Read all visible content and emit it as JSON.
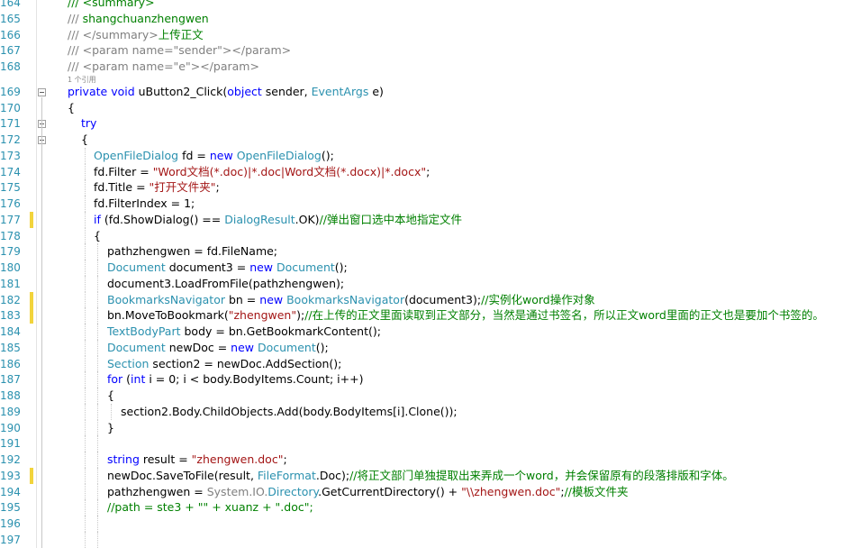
{
  "editor": {
    "reference_hint": "1 个引用",
    "lines": [
      {
        "n": "164",
        "indent": 0,
        "segs": [
          [
            "c",
            "/// <summary>"
          ]
        ]
      },
      {
        "n": "165",
        "indent": 0,
        "segs": [
          [
            "g",
            "/// "
          ],
          [
            "c",
            "shangchuanzhengwen"
          ]
        ]
      },
      {
        "n": "166",
        "indent": 0,
        "segs": [
          [
            "g",
            "/// </summary>"
          ],
          [
            "c",
            "上传正文"
          ]
        ]
      },
      {
        "n": "167",
        "indent": 0,
        "segs": [
          [
            "g",
            "/// <param name=\"sender\"></param>"
          ]
        ]
      },
      {
        "n": "168",
        "indent": 0,
        "segs": [
          [
            "g",
            "/// <param name=\"e\"></param>"
          ]
        ]
      },
      {
        "n": "169",
        "indent": 0,
        "segs": [
          [
            "k",
            "private"
          ],
          [
            "p",
            " "
          ],
          [
            "k",
            "void"
          ],
          [
            "p",
            " uButton2_Click("
          ],
          [
            "k",
            "object"
          ],
          [
            "p",
            " sender, "
          ],
          [
            "t",
            "EventArgs"
          ],
          [
            "p",
            " e)"
          ]
        ]
      },
      {
        "n": "170",
        "indent": 0,
        "segs": [
          [
            "p",
            "{"
          ]
        ]
      },
      {
        "n": "171",
        "indent": 1,
        "segs": [
          [
            "k",
            "try"
          ]
        ]
      },
      {
        "n": "172",
        "indent": 1,
        "segs": [
          [
            "p",
            "{"
          ]
        ]
      },
      {
        "n": "173",
        "indent": 2,
        "segs": [
          [
            "t",
            "OpenFileDialog"
          ],
          [
            "p",
            " fd = "
          ],
          [
            "k",
            "new"
          ],
          [
            "p",
            " "
          ],
          [
            "t",
            "OpenFileDialog"
          ],
          [
            "p",
            "();"
          ]
        ]
      },
      {
        "n": "174",
        "indent": 2,
        "segs": [
          [
            "p",
            "fd.Filter = "
          ],
          [
            "s",
            "\"Word文档(*.doc)|*.doc|Word文档(*.docx)|*.docx\""
          ],
          [
            "p",
            ";"
          ]
        ]
      },
      {
        "n": "175",
        "indent": 2,
        "segs": [
          [
            "p",
            "fd.Title = "
          ],
          [
            "s",
            "\"打开文件夹\""
          ],
          [
            "p",
            ";"
          ]
        ]
      },
      {
        "n": "176",
        "indent": 2,
        "segs": [
          [
            "p",
            "fd.FilterIndex = 1;"
          ]
        ]
      },
      {
        "n": "177",
        "indent": 2,
        "segs": [
          [
            "k",
            "if"
          ],
          [
            "p",
            " (fd.ShowDialog() == "
          ],
          [
            "t",
            "DialogResult"
          ],
          [
            "p",
            ".OK)"
          ],
          [
            "c",
            "//弹出窗口选中本地指定文件"
          ]
        ]
      },
      {
        "n": "178",
        "indent": 2,
        "segs": [
          [
            "p",
            "{"
          ]
        ]
      },
      {
        "n": "179",
        "indent": 3,
        "segs": [
          [
            "p",
            "pathzhengwen = fd.FileName;"
          ]
        ]
      },
      {
        "n": "180",
        "indent": 3,
        "segs": [
          [
            "t",
            "Document"
          ],
          [
            "p",
            " document3 = "
          ],
          [
            "k",
            "new"
          ],
          [
            "p",
            " "
          ],
          [
            "t",
            "Document"
          ],
          [
            "p",
            "();"
          ]
        ]
      },
      {
        "n": "181",
        "indent": 3,
        "segs": [
          [
            "p",
            "document3.LoadFromFile(pathzhengwen);"
          ]
        ]
      },
      {
        "n": "182",
        "indent": 3,
        "segs": [
          [
            "t",
            "BookmarksNavigator"
          ],
          [
            "p",
            " bn = "
          ],
          [
            "k",
            "new"
          ],
          [
            "p",
            " "
          ],
          [
            "t",
            "BookmarksNavigator"
          ],
          [
            "p",
            "(document3);"
          ],
          [
            "c",
            "//实例化word操作对象"
          ]
        ]
      },
      {
        "n": "183",
        "indent": 3,
        "segs": [
          [
            "p",
            "bn.MoveToBookmark("
          ],
          [
            "s",
            "\"zhengwen\""
          ],
          [
            "p",
            ");"
          ],
          [
            "c",
            "//在上传的正文里面读取到正文部分，当然是通过书签名，所以正文word里面的正文也是要加个书签的。"
          ]
        ]
      },
      {
        "n": "184",
        "indent": 3,
        "segs": [
          [
            "t",
            "TextBodyPart"
          ],
          [
            "p",
            " body = bn.GetBookmarkContent();"
          ]
        ]
      },
      {
        "n": "185",
        "indent": 3,
        "segs": [
          [
            "t",
            "Document"
          ],
          [
            "p",
            " newDoc = "
          ],
          [
            "k",
            "new"
          ],
          [
            "p",
            " "
          ],
          [
            "t",
            "Document"
          ],
          [
            "p",
            "();"
          ]
        ]
      },
      {
        "n": "186",
        "indent": 3,
        "segs": [
          [
            "t",
            "Section"
          ],
          [
            "p",
            " section2 = newDoc.AddSection();"
          ]
        ]
      },
      {
        "n": "187",
        "indent": 3,
        "segs": [
          [
            "k",
            "for"
          ],
          [
            "p",
            " ("
          ],
          [
            "k",
            "int"
          ],
          [
            "p",
            " i = 0; i < body.BodyItems.Count; i++)"
          ]
        ]
      },
      {
        "n": "188",
        "indent": 3,
        "segs": [
          [
            "p",
            "{"
          ]
        ]
      },
      {
        "n": "189",
        "indent": 4,
        "segs": [
          [
            "p",
            "section2.Body.ChildObjects.Add(body.BodyItems[i].Clone());"
          ]
        ]
      },
      {
        "n": "190",
        "indent": 3,
        "segs": [
          [
            "p",
            "}"
          ]
        ]
      },
      {
        "n": "191",
        "indent": 3,
        "segs": []
      },
      {
        "n": "192",
        "indent": 3,
        "segs": [
          [
            "k",
            "string"
          ],
          [
            "p",
            " result = "
          ],
          [
            "s",
            "\"zhengwen.doc\""
          ],
          [
            "p",
            ";"
          ]
        ]
      },
      {
        "n": "193",
        "indent": 3,
        "segs": [
          [
            "p",
            "newDoc.SaveToFile(result, "
          ],
          [
            "t",
            "FileFormat"
          ],
          [
            "p",
            ".Doc);"
          ],
          [
            "c",
            "//将正文部门单独提取出来弄成一个word，并会保留原有的段落排版和字体。"
          ]
        ]
      },
      {
        "n": "194",
        "indent": 3,
        "segs": [
          [
            "p",
            "pathzhengwen = "
          ],
          [
            "g",
            "System.IO."
          ],
          [
            "t",
            "Directory"
          ],
          [
            "p",
            ".GetCurrentDirectory() + "
          ],
          [
            "s",
            "\"\\\\zhengwen.doc\""
          ],
          [
            "p",
            ";"
          ],
          [
            "c",
            "//模板文件夹"
          ]
        ]
      },
      {
        "n": "195",
        "indent": 3,
        "segs": [
          [
            "c",
            "//path = ste3 + \"\" + xuanz + \".doc\";"
          ]
        ]
      },
      {
        "n": "196",
        "indent": 3,
        "segs": []
      },
      {
        "n": "197",
        "indent": 3,
        "segs": []
      }
    ]
  },
  "change_marker_color": "#f2d43c",
  "colors": {
    "keyword": "#0000ff",
    "type": "#2b91af",
    "string": "#a31515",
    "comment": "#008000",
    "doc_comment": "#808080"
  }
}
